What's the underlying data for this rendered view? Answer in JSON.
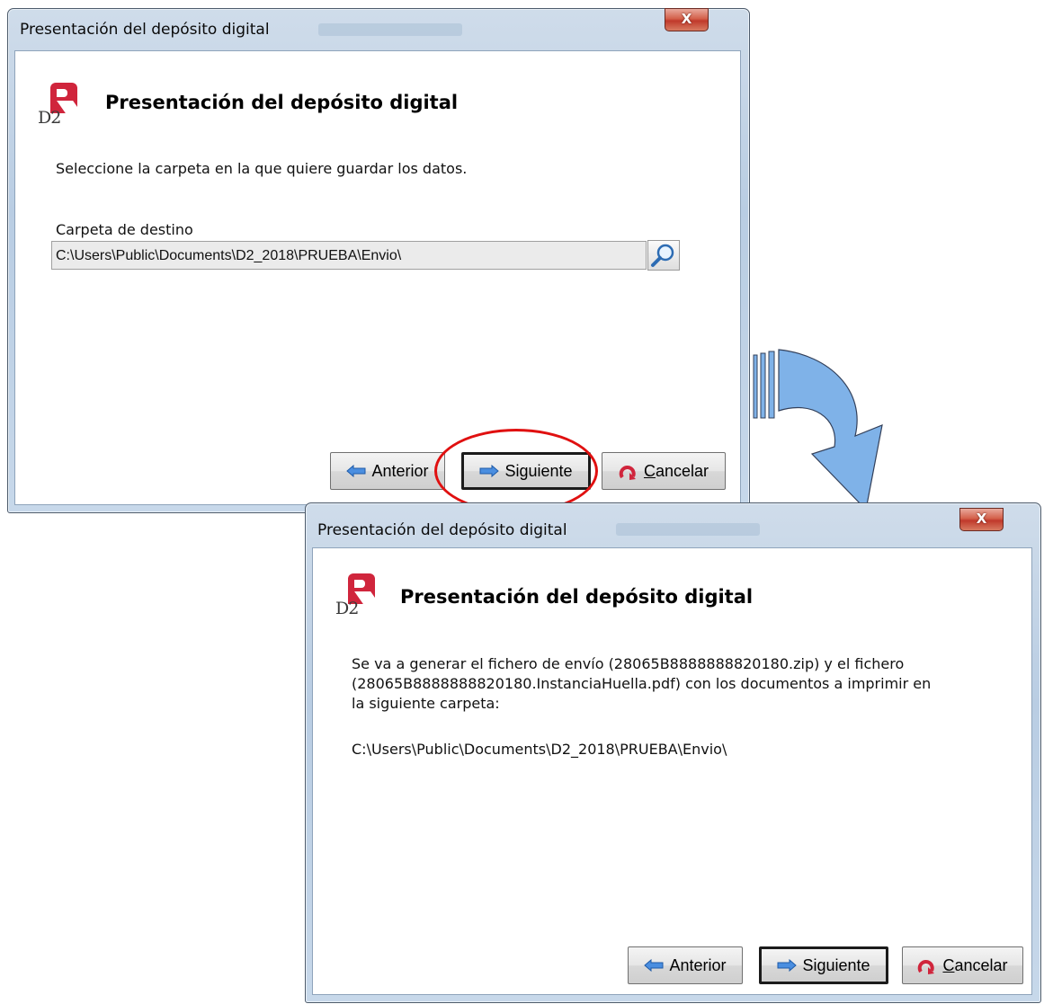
{
  "window1": {
    "title": "Presentación del depósito digital",
    "close_glyph": "X",
    "heading": "Presentación del depósito digital",
    "instruction": "Seleccione la carpeta en la que quiere guardar los datos.",
    "folder_label": "Carpeta de destino",
    "folder_value": "C:\\Users\\Public\\Documents\\D2_2018\\PRUEBA\\Envio\\",
    "buttons": {
      "prev": "Anterior",
      "next": "Siguiente",
      "cancel_first": "C",
      "cancel_rest": "ancelar"
    }
  },
  "window2": {
    "title": "Presentación del depósito digital",
    "close_glyph": "X",
    "heading": "Presentación del depósito digital",
    "message_line1": "Se va a generar el fichero de envío (28065B8888888820180.zip) y el fichero",
    "message_line2": "(28065B8888888820180.InstanciaHuella.pdf) con los documentos a imprimir en",
    "message_line3": "la siguiente carpeta:",
    "folder_path": "C:\\Users\\Public\\Documents\\D2_2018\\PRUEBA\\Envio\\",
    "buttons": {
      "prev": "Anterior",
      "next": "Siguiente",
      "cancel_first": "C",
      "cancel_rest": "ancelar"
    }
  },
  "logo": {
    "text": "D2"
  },
  "colors": {
    "callout": "#e01010",
    "arrow": "#7fb2e8",
    "brand": "#d0253c"
  },
  "icons": [
    "close-icon",
    "d2-logo-icon",
    "search-icon",
    "arrow-left-icon",
    "arrow-right-icon",
    "cancel-icon",
    "flow-arrow-icon"
  ]
}
